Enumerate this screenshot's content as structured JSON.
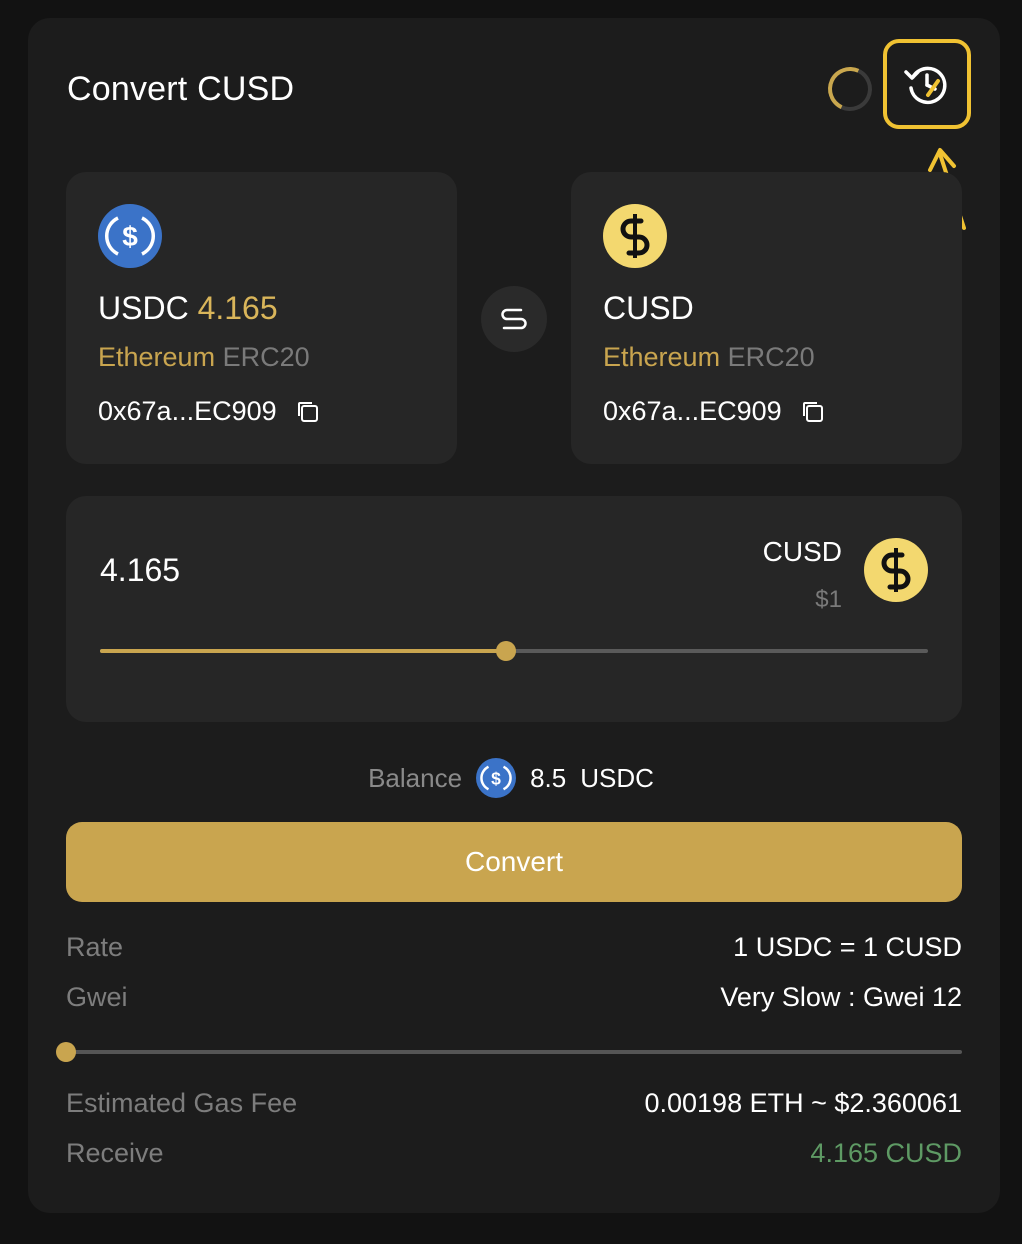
{
  "header": {
    "title": "Convert CUSD",
    "history_icon": "history-clock-icon",
    "spinner_icon": "loading-spinner-icon"
  },
  "from_card": {
    "token": "USDC",
    "amount": "4.165",
    "chain": "Ethereum",
    "standard": "ERC20",
    "address": "0x67a...EC909",
    "icon": "usdc-coin-icon"
  },
  "to_card": {
    "token": "CUSD",
    "chain": "Ethereum",
    "standard": "ERC20",
    "address": "0x67a...EC909",
    "icon": "cusd-coin-icon"
  },
  "amount_panel": {
    "value": "4.165",
    "currency": "CUSD",
    "price": "$1",
    "slider_fraction": 0.49
  },
  "balance": {
    "label": "Balance",
    "amount": "8.5",
    "token": "USDC"
  },
  "convert_label": "Convert",
  "details": {
    "rate_label": "Rate",
    "rate_value": "1 USDC = 1 CUSD",
    "gwei_label": "Gwei",
    "gwei_value": "Very Slow : Gwei 12",
    "gas_slider_fraction": 0.0,
    "gas_fee_label": "Estimated Gas Fee",
    "gas_fee_value": "0.00198 ETH ~ $2.360061",
    "receive_label": "Receive",
    "receive_value": "4.165 CUSD"
  },
  "colors": {
    "accent": "#c9a54f",
    "highlight": "#f0c232",
    "usdc_blue": "#3b73c8",
    "cusd_yellow": "#f3d86f",
    "receive_green": "#5e9a64"
  }
}
